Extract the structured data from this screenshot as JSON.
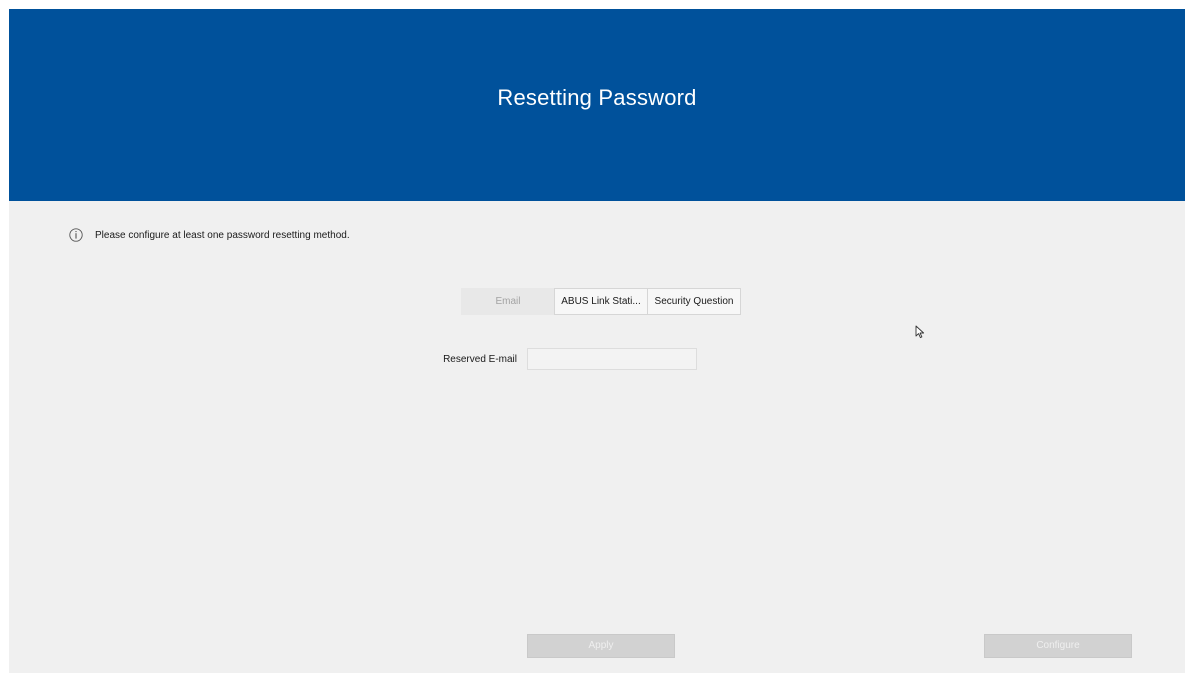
{
  "header": {
    "title": "Resetting Password",
    "background_color": "#00519b"
  },
  "notice": {
    "icon": "info-icon",
    "text": "Please configure at least one password resetting method."
  },
  "tabs": [
    {
      "label": "Email",
      "active": true
    },
    {
      "label": "ABUS Link Stati...",
      "active": false
    },
    {
      "label": "Security Question",
      "active": false
    }
  ],
  "form": {
    "reserved_email": {
      "label": "Reserved E-mail",
      "value": "",
      "placeholder": ""
    }
  },
  "buttons": {
    "apply": "Apply",
    "configure": "Configure"
  }
}
